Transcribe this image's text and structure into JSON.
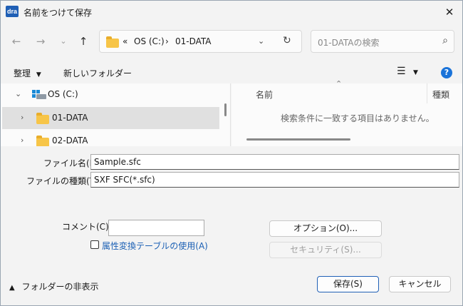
{
  "window": {
    "title": "名前をつけて保存",
    "app_icon_text": "dra"
  },
  "nav": {
    "breadcrumb_overflow": "«",
    "breadcrumb": [
      "OS (C:)",
      "01-DATA"
    ],
    "breadcrumb_separator": "›",
    "search_placeholder": "01-DATAの検索"
  },
  "toolbar": {
    "organize_label": "整理",
    "new_folder_label": "新しいフォルダー"
  },
  "tree": {
    "items": [
      {
        "label": "OS (C:)",
        "expanded": true
      },
      {
        "label": "01-DATA",
        "selected": true
      },
      {
        "label": "02-DATA"
      }
    ]
  },
  "file_list": {
    "columns": [
      "名前",
      "種類"
    ],
    "empty_message": "検索条件に一致する項目はありません。"
  },
  "form": {
    "filename_label": "ファイル名(N):",
    "filename_value": "Sample.sfc",
    "filetype_label": "ファイルの種類(T):",
    "filetype_value": "SXF SFC(*.sfc)",
    "comment_label": "コメント(C)：",
    "comment_value": "",
    "attr_table_label": "属性変換テーブルの使用(A)",
    "attr_table_checked": false,
    "option_button": "オプション(O)...",
    "security_button": "セキュリティ(S)..."
  },
  "footer": {
    "hide_folders_label": "フォルダーの非表示",
    "save_button": "保存(S)",
    "cancel_button": "キャンセル"
  },
  "colors": {
    "accent": "#1a73d9",
    "folder": "#f7c548",
    "selection": "#e0e0e0"
  }
}
